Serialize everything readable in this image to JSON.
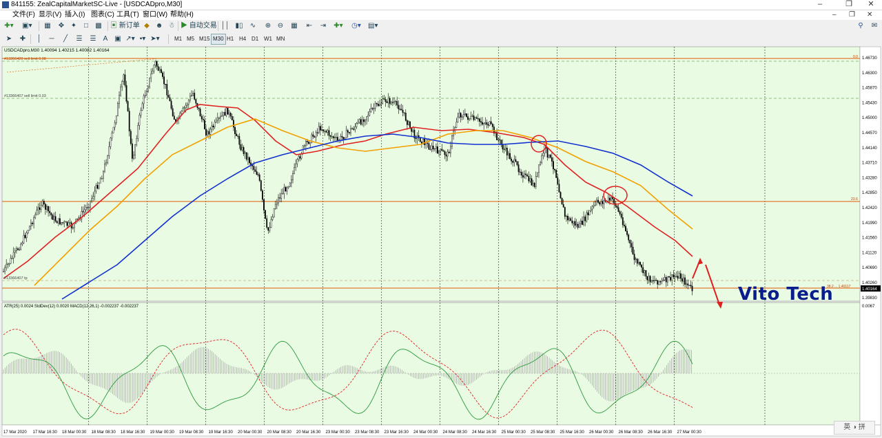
{
  "window": {
    "title": "841155: ZealCapitalMarketSC-Live - [USDCADpro,M30]"
  },
  "menu": [
    "文件(F)",
    "显示(V)",
    "插入(I)",
    "图表(C)",
    "工具(T)",
    "窗口(W)",
    "帮助(H)"
  ],
  "toolbar": {
    "new_order_label": "新订单",
    "auto_trade_label": "自动交易"
  },
  "timeframes": [
    "M1",
    "M5",
    "M15",
    "M30",
    "H1",
    "H4",
    "D1",
    "W1",
    "MN"
  ],
  "active_timeframe": "M30",
  "chart": {
    "header": "USDCADpro,M30  1.40094 1.40215 1.40082 1.40164",
    "symbol": "USDCADpro,M30",
    "ohlc": "1.40094 1.40215 1.40082 1.40164",
    "current_price": "1.40164",
    "price_axis": [
      "1.46730",
      "1.46300",
      "1.45870",
      "1.45430",
      "1.45000",
      "1.44570",
      "1.44140",
      "1.43710",
      "1.43280",
      "1.42850",
      "1.42420",
      "1.41990",
      "1.41560",
      "1.41120",
      "1.40690",
      "1.40260",
      "1.39830"
    ],
    "time_axis": [
      "17 Mar 2020",
      "17 Mar 16:30",
      "18 Mar 00:30",
      "18 Mar 08:30",
      "18 Mar 16:30",
      "19 Mar 00:30",
      "19 Mar 08:30",
      "19 Mar 16:30",
      "20 Mar 00:30",
      "20 Mar 08:30",
      "20 Mar 16:30",
      "23 Mar 00:30",
      "23 Mar 08:30",
      "23 Mar 16:30",
      "24 Mar 00:30",
      "24 Mar 08:30",
      "24 Mar 16:30",
      "25 Mar 00:30",
      "25 Mar 08:30",
      "25 Mar 16:30",
      "26 Mar 00:30",
      "26 Mar 08:30",
      "26 Mar 16:30",
      "27 Mar 00:30"
    ],
    "order_lines": {
      "sell_limit_008": "#13366420 sell limit 0.08",
      "sell_limit_003": "#13366407 sell limit 0.03",
      "tp": "#13366407 tp"
    },
    "fib_labels": {
      "top": "0.0",
      "mid": "23.6",
      "low": "38.2 ... 1.40117"
    },
    "moving_average_colors": {
      "fast": "#e02020",
      "medium": "#f2a000",
      "slow": "#1030d0"
    },
    "indicator_header": "ATR(25) 0.0024  StdDev(12) 0.0020  MACD(12,26,1) -0.002237 -0.002237",
    "indicator_axis": "0.0067"
  },
  "watermark": "Vito Tech",
  "ime": "英 ◑ 拼"
}
